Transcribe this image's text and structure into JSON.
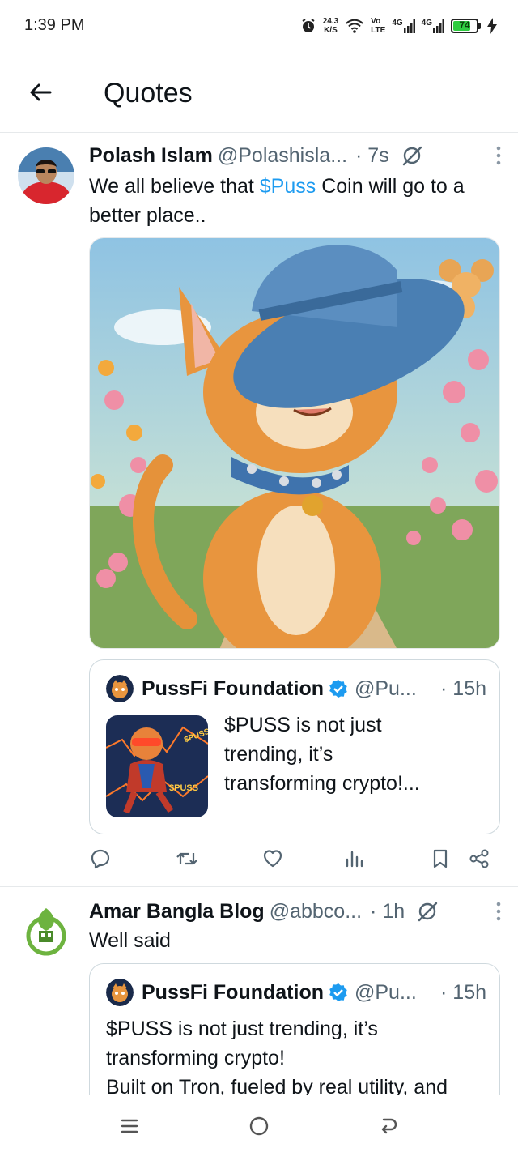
{
  "status_bar": {
    "time": "1:39 PM",
    "net_speed_value": "24.3",
    "net_speed_unit": "K/S",
    "volte_top": "Vo",
    "volte_bottom": "LTE",
    "signal1_label": "4G",
    "signal2_label": "4G",
    "battery_level": "74",
    "icons": [
      "alarm-icon",
      "wifi-icon",
      "signal-icon",
      "battery-icon",
      "charging-icon"
    ]
  },
  "header": {
    "back_icon": "arrow-left-icon",
    "title": "Quotes"
  },
  "colors": {
    "link": "#1d9bf0",
    "text": "#0f1419",
    "muted": "#536471",
    "verified": "#1d9bf0",
    "battery": "#2ecc40"
  },
  "tweets": [
    {
      "author": "Polash Islam",
      "handle": "@Polashisla...",
      "time": "· 7s",
      "text_before": "We all believe that ",
      "cashtag": "$Puss",
      "text_after": " Coin will go to a better place..",
      "media_icon": "cartoon-cat-in-blue-hat-image",
      "quote": {
        "author": "PussFi Foundation",
        "handle": "@Pu...",
        "time": "· 15h",
        "text": "$PUSS is not just trending,  it’s transforming crypto!...",
        "text_line1": "$PUSS is not just",
        "text_line2": "trending,  it’s",
        "text_line3": "transforming crypto!...",
        "thumb_label_1": "$PUSS",
        "thumb_label_2": "$PUSS"
      },
      "actions": [
        "reply-icon",
        "retweet-icon",
        "like-icon",
        "views-icon",
        "bookmark-icon",
        "share-icon"
      ]
    },
    {
      "author": "Amar Bangla Blog",
      "handle": "@abbco...",
      "time": "· 1h",
      "text": "Well said",
      "quote": {
        "author": "PussFi Foundation",
        "handle": "@Pu...",
        "time": "· 15h",
        "text_line1": "$PUSS is not just trending,  it’s",
        "text_line2": "transforming crypto!",
        "text_line3": "Built on Tron, fueled by real utility, and"
      }
    }
  ],
  "nav_bar": [
    "recents-icon",
    "home-icon",
    "back-icon"
  ]
}
